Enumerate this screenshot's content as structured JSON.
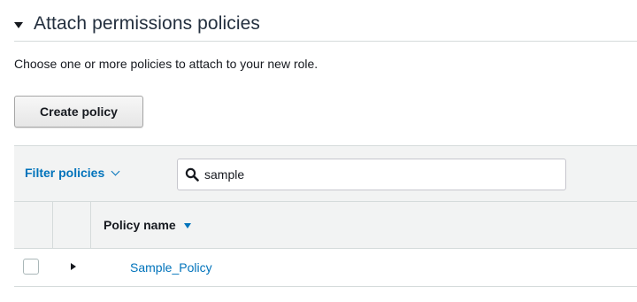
{
  "section": {
    "title": "Attach permissions policies",
    "description": "Choose one or more policies to attach to your new role."
  },
  "toolbar": {
    "create_policy_label": "Create policy"
  },
  "filter": {
    "label": "Filter policies",
    "search_value": "sample"
  },
  "table": {
    "columns": [
      "Policy name"
    ],
    "rows": [
      {
        "name": "Sample_Policy",
        "checked": false,
        "expanded": false
      }
    ]
  },
  "icons": {
    "section_toggle": "caret-down-icon",
    "filter_dropdown": "chevron-down-icon",
    "search": "search-icon",
    "sort": "sort-descending-icon",
    "row_expand": "caret-right-icon"
  },
  "colors": {
    "link": "#0073bb",
    "table_header_bg": "#f2f3f3",
    "border": "#d5dbdb"
  }
}
